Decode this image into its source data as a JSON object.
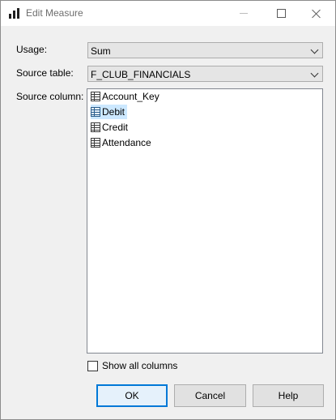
{
  "window": {
    "title": "Edit Measure",
    "icon": "bar-chart-icon"
  },
  "form": {
    "usage": {
      "label": "Usage:",
      "value": "Sum"
    },
    "source_table": {
      "label": "Source table:",
      "value": "F_CLUB_FINANCIALS"
    },
    "source_column": {
      "label": "Source column:",
      "items": [
        {
          "text": "Account_Key",
          "icon": "table-column-icon",
          "selected": false
        },
        {
          "text": "Debit",
          "icon": "table-column-icon",
          "selected": true
        },
        {
          "text": "Credit",
          "icon": "table-column-icon",
          "selected": false
        },
        {
          "text": "Attendance",
          "icon": "table-column-icon",
          "selected": false
        }
      ]
    },
    "show_all_columns": {
      "label": "Show all columns",
      "checked": false
    }
  },
  "buttons": {
    "ok": "OK",
    "cancel": "Cancel",
    "help": "Help"
  },
  "colors": {
    "selection": "#cce8ff",
    "default_button_border": "#0078d7"
  }
}
